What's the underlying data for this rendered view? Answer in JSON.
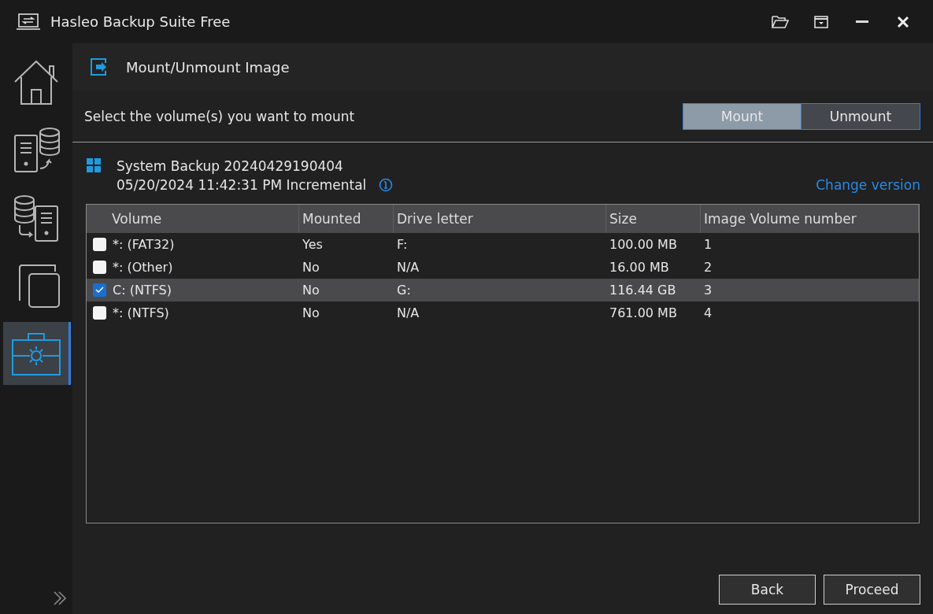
{
  "window": {
    "title": "Hasleo Backup Suite Free"
  },
  "sidebar": {
    "items": [
      {
        "kind": "home",
        "selected": false
      },
      {
        "kind": "backup",
        "selected": false
      },
      {
        "kind": "restore",
        "selected": false
      },
      {
        "kind": "clone",
        "selected": false
      },
      {
        "kind": "tools",
        "selected": true
      }
    ]
  },
  "page": {
    "title": "Mount/Unmount Image",
    "instruction": "Select the volume(s) you want to mount"
  },
  "mode_toggle": [
    {
      "label": "Mount",
      "selected": true
    },
    {
      "label": "Unmount",
      "selected": false
    }
  ],
  "backup": {
    "name": "System Backup 20240429190404",
    "details": "05/20/2024 11:42:31 PM Incremental",
    "change_link": "Change version"
  },
  "table": {
    "columns": [
      "Volume",
      "Mounted",
      "Drive letter",
      "Size",
      "Image Volume number"
    ],
    "rows": [
      {
        "checked": false,
        "selected": false,
        "cells": [
          "*: (FAT32)",
          "Yes",
          "F:",
          "100.00 MB",
          "1"
        ]
      },
      {
        "checked": false,
        "selected": false,
        "cells": [
          "*: (Other)",
          "No",
          "N/A",
          "16.00 MB",
          "2"
        ]
      },
      {
        "checked": true,
        "selected": true,
        "cells": [
          "C: (NTFS)",
          "No",
          "G:",
          "116.44 GB",
          "3"
        ]
      },
      {
        "checked": false,
        "selected": false,
        "cells": [
          "*: (NTFS)",
          "No",
          "N/A",
          "761.00 MB",
          "4"
        ]
      }
    ]
  },
  "buttons": [
    "Back",
    "Proceed"
  ]
}
